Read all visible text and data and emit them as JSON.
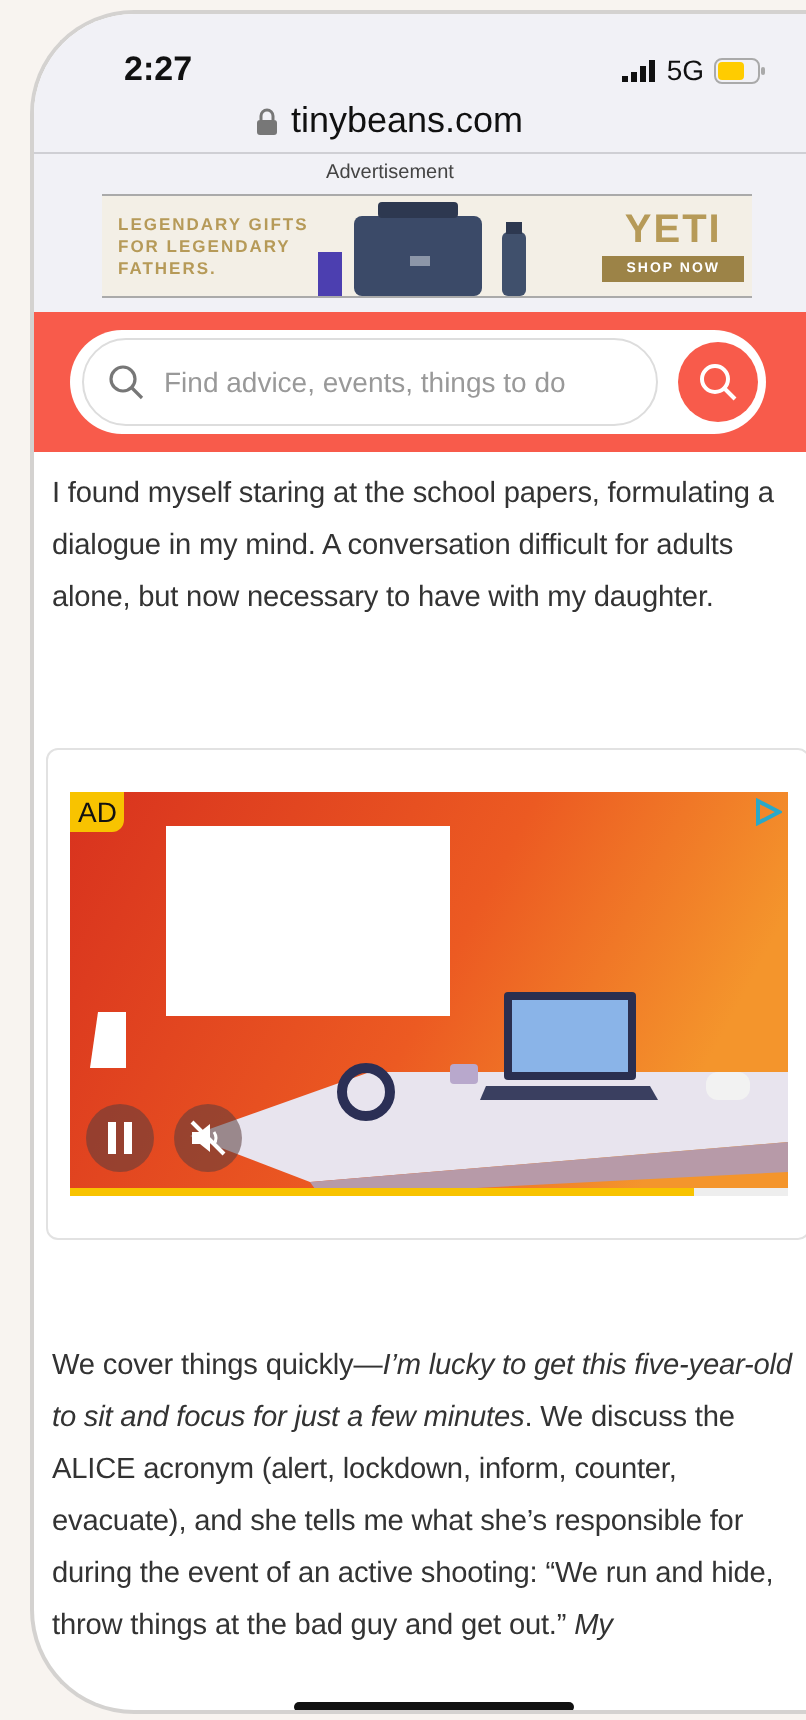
{
  "status_bar": {
    "time": "2:27",
    "network": "5G"
  },
  "address_bar": {
    "url": "tinybeans.com"
  },
  "top_ad": {
    "label": "Advertisement",
    "headline": "LEGENDARY GIFTS FOR LEGENDARY FATHERS.",
    "brand": "YETI",
    "button": "SHOP NOW"
  },
  "search": {
    "placeholder": "Find advice, events, things to do"
  },
  "article_intro": "I found myself staring at the school papers, formulating a dialogue in my mind. A conversation difficult for adults alone, but now necessary to have with my daughter.",
  "video_ad": {
    "badge": "AD",
    "playing": true,
    "muted": true,
    "level": 0.87
  },
  "article_continued": "We cover things quickly—*I’m lucky to get this five-year-old to sit and focus for just a few minutes*. We discuss the ALICE acronym (alert, lockdown, inform, counter, evacuate), and she tells me what she’s responsible for during the event of an active shooting: “We run and hide, throw things at the bad guy and get out.” *My*"
}
